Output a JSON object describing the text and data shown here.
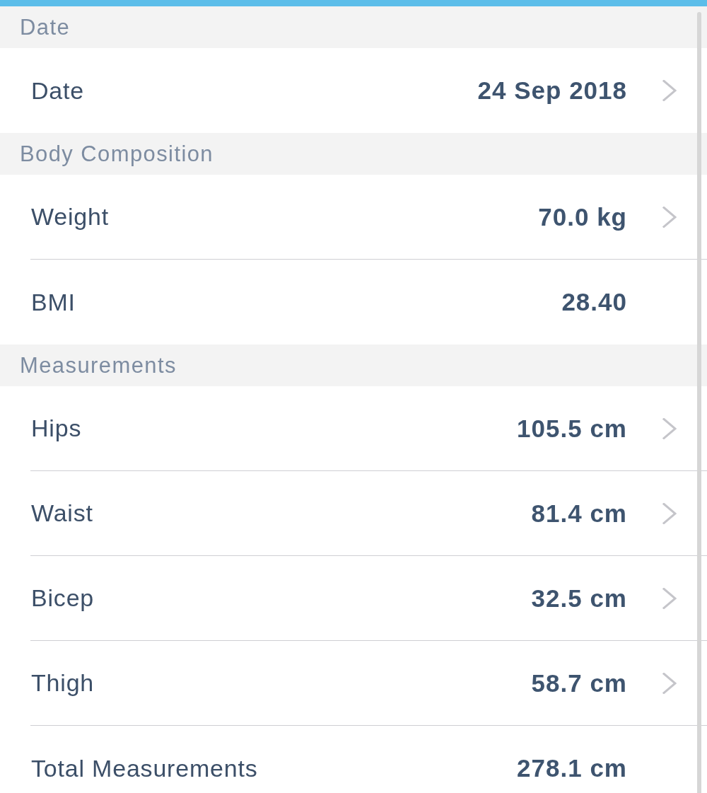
{
  "sections": [
    {
      "title": "Date",
      "rows": [
        {
          "label": "Date",
          "value": "24 Sep 2018",
          "disclosure": true
        }
      ]
    },
    {
      "title": "Body Composition",
      "rows": [
        {
          "label": "Weight",
          "value": "70.0 kg",
          "disclosure": true
        },
        {
          "label": "BMI",
          "value": "28.40",
          "disclosure": false
        }
      ]
    },
    {
      "title": "Measurements",
      "rows": [
        {
          "label": "Hips",
          "value": "105.5 cm",
          "disclosure": true
        },
        {
          "label": "Waist",
          "value": "81.4 cm",
          "disclosure": true
        },
        {
          "label": "Bicep",
          "value": "32.5 cm",
          "disclosure": true
        },
        {
          "label": "Thigh",
          "value": "58.7 cm",
          "disclosure": true
        },
        {
          "label": "Total Measurements",
          "value": "278.1 cm",
          "disclosure": false
        }
      ]
    }
  ]
}
